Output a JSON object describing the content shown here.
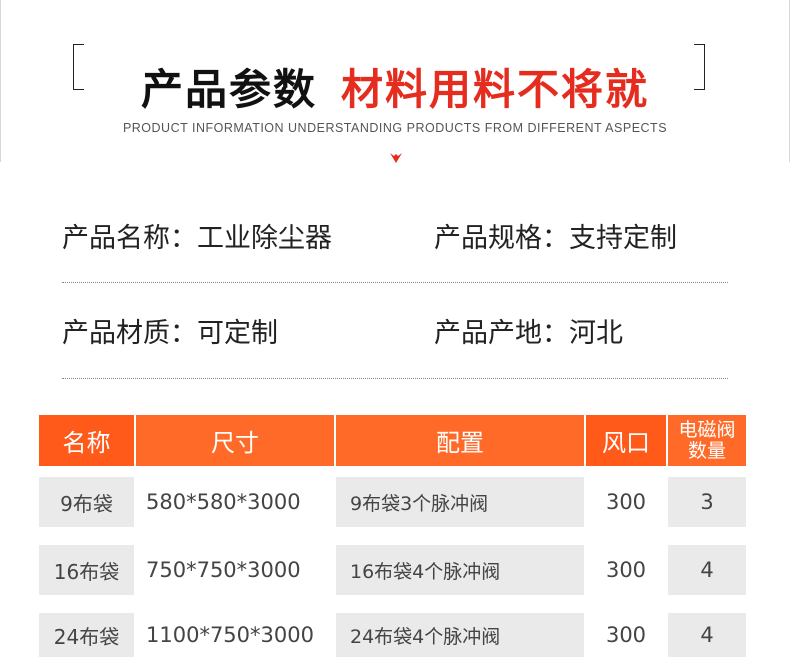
{
  "header": {
    "title_black": "产品参数",
    "title_red": "材料用料不将就",
    "subtitle": "PRODUCT INFORMATION UNDERSTANDING PRODUCTS FROM DIFFERENT ASPECTS",
    "accent_color": "#e52d1f"
  },
  "info": {
    "row1": {
      "left": "产品名称：工业除尘器",
      "right": "产品规格：支持定制"
    },
    "row2": {
      "left": "产品材质：可定制",
      "right": "产品产地：河北"
    }
  },
  "table": {
    "header_color": "#ff6a28",
    "headers": {
      "name": "名称",
      "size": "尺寸",
      "config": "配置",
      "vent": "风口",
      "valve_line1": "电磁阀",
      "valve_line2": "数量"
    },
    "rows": [
      {
        "name": "9布袋",
        "size": "580*580*3000",
        "config": "9布袋3个脉冲阀",
        "vent": "300",
        "valves": "3"
      },
      {
        "name": "16布袋",
        "size": "750*750*3000",
        "config": "16布袋4个脉冲阀",
        "vent": "300",
        "valves": "4"
      },
      {
        "name": "24布袋",
        "size": "1100*750*3000",
        "config": "24布袋4个脉冲阀",
        "vent": "300",
        "valves": "4"
      }
    ]
  }
}
